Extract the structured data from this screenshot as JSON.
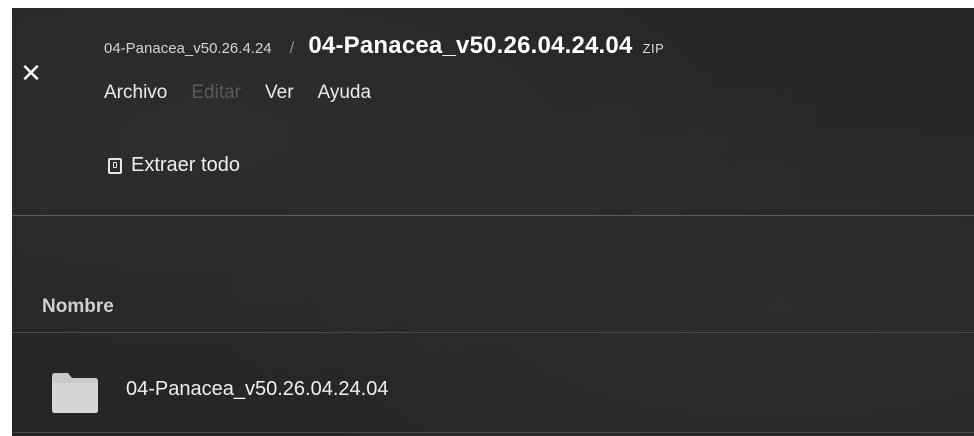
{
  "window": {
    "close_glyph": "✕",
    "breadcrumb_parent": "04-Panacea_v50.26.4.24",
    "breadcrumb_separator": "/",
    "breadcrumb_current": "04-Panacea_v50.26.04.24.04",
    "file_type": "ZIP"
  },
  "menu": {
    "items": [
      {
        "label": "Archivo",
        "enabled": true
      },
      {
        "label": "Editar",
        "enabled": false
      },
      {
        "label": "Ver",
        "enabled": true
      },
      {
        "label": "Ayuda",
        "enabled": true
      }
    ]
  },
  "toolbar": {
    "extract_all_label": "Extraer todo",
    "extract_all_icon": "archive-extract-icon"
  },
  "file_list": {
    "column_header": "Nombre",
    "items": [
      {
        "name": "04-Panacea_v50.26.04.24.04",
        "type": "folder",
        "icon": "folder-icon"
      }
    ]
  },
  "colors": {
    "background": "#262626",
    "text": "#e9e9e9",
    "folder": "#c9c9c9"
  }
}
